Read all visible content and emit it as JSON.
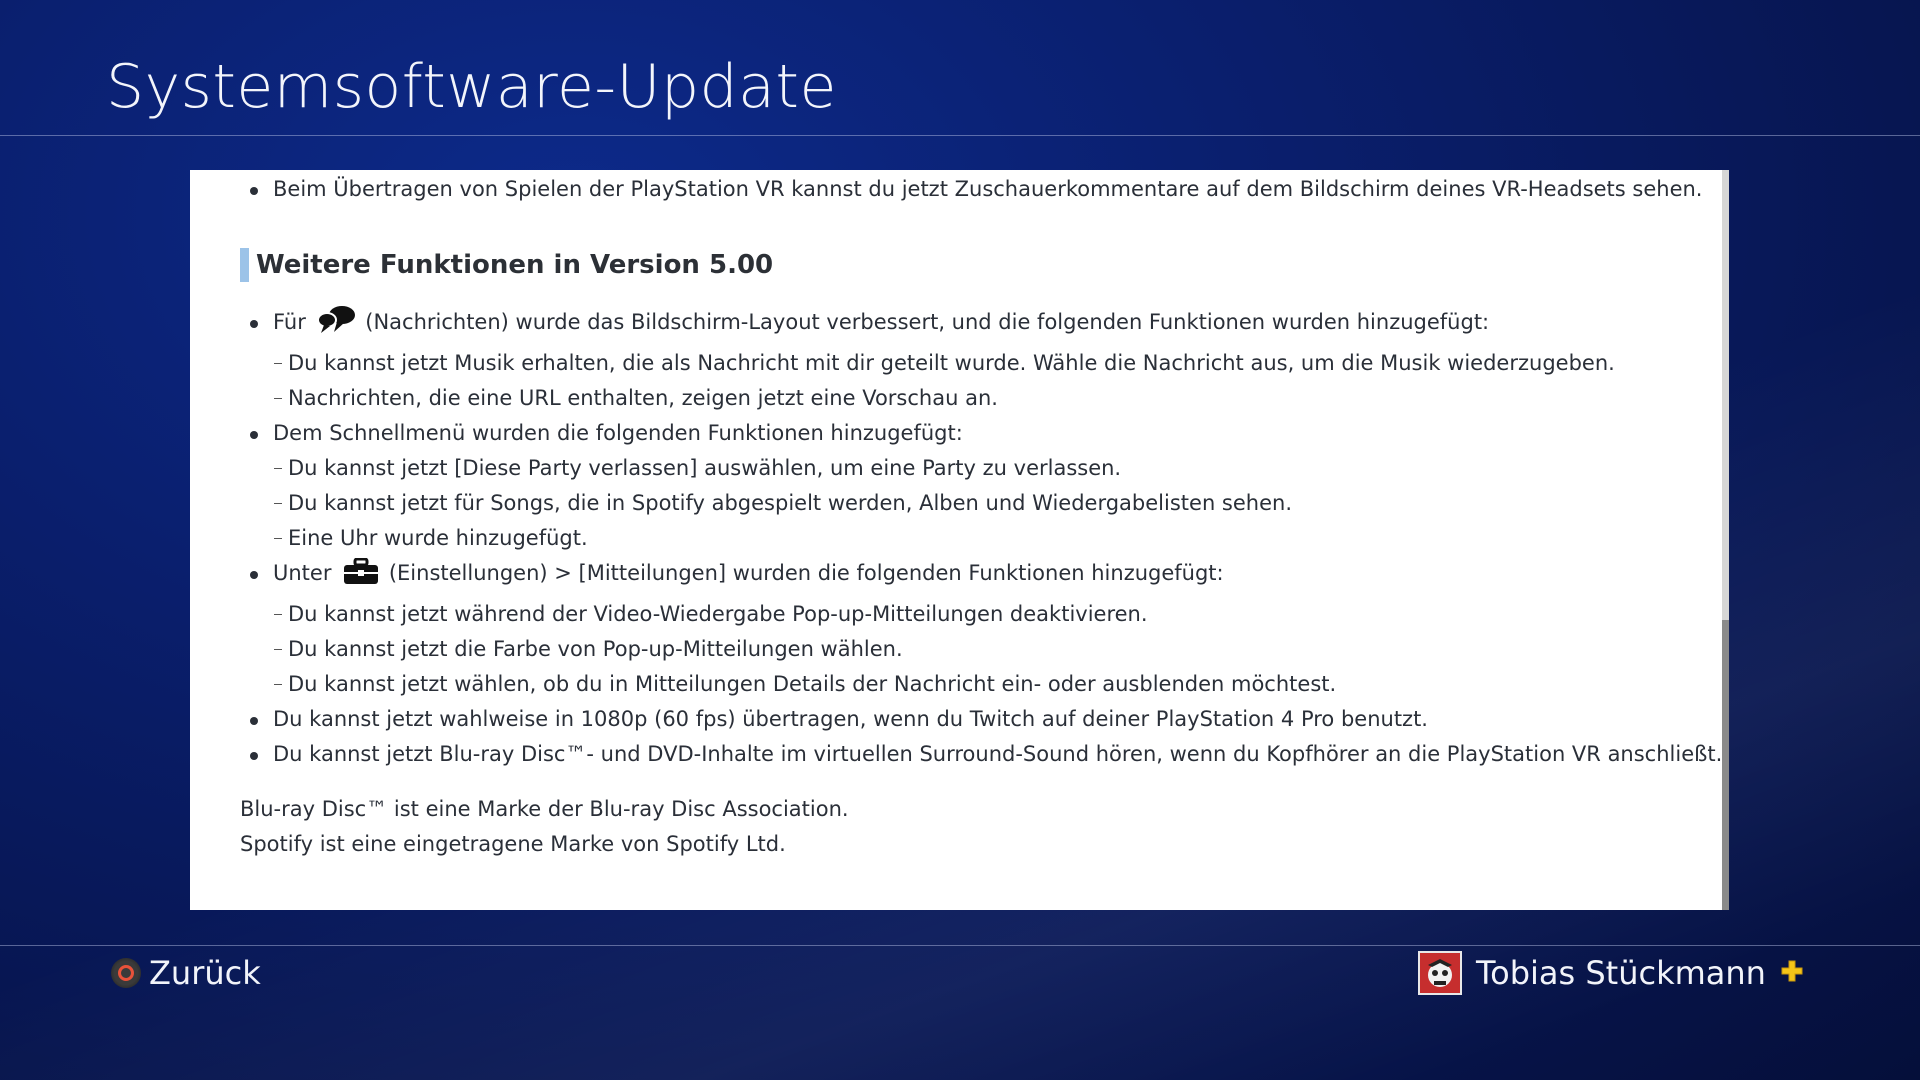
{
  "header": {
    "title": "Systemsoftware-Update"
  },
  "content": {
    "intro_bullet": "Beim Übertragen von Spielen der PlayStation VR kannst du jetzt Zuschauerkommentare auf dem Bildschirm deines VR-Headsets sehen.",
    "section_heading": "Weitere Funktionen in Version 5.00",
    "messages_bullet": {
      "prefix": "Für",
      "icon": "messages-icon",
      "suffix": "(Nachrichten) wurde das Bildschirm-Layout verbessert, und die folgenden Funktionen wurden hinzugefügt:",
      "subs": [
        "Du kannst jetzt Musik erhalten, die als Nachricht mit dir geteilt wurde. Wähle die Nachricht aus, um die Musik wiederzugeben.",
        "Nachrichten, die eine URL enthalten, zeigen jetzt eine Vorschau an."
      ]
    },
    "quickmenu_bullet": {
      "text": "Dem Schnellmenü wurden die folgenden Funktionen hinzugefügt:",
      "subs": [
        "Du kannst jetzt [Diese Party verlassen] auswählen, um eine Party zu verlassen.",
        "Du kannst jetzt für Songs, die in Spotify abgespielt werden, Alben und Wiedergabelisten sehen.",
        "Eine Uhr wurde hinzugefügt."
      ]
    },
    "settings_bullet": {
      "prefix": "Unter",
      "icon": "settings-toolbox-icon",
      "suffix": "(Einstellungen) > [Mitteilungen] wurden die folgenden Funktionen hinzugefügt:",
      "subs": [
        "Du kannst jetzt während der Video-Wiedergabe Pop-up-Mitteilungen deaktivieren.",
        "Du kannst jetzt die Farbe von Pop-up-Mitteilungen wählen.",
        "Du kannst jetzt wählen, ob du in Mitteilungen Details der Nachricht ein- oder ausblenden möchtest."
      ]
    },
    "twitch_bullet": "Du kannst jetzt wahlweise in 1080p (60 fps) übertragen, wenn du Twitch auf deiner PlayStation 4 Pro benutzt.",
    "bluray_bullet": "Du kannst jetzt Blu-ray Disc™- und DVD-Inhalte im virtuellen Surround-Sound hören, wenn du Kopfhörer an die PlayStation VR anschließt.",
    "notes": [
      "Blu-ray Disc™ ist eine Marke der Blu-ray Disc Association.",
      "Spotify ist eine eingetragene Marke von Spotify Ltd."
    ]
  },
  "footer": {
    "back_label": "Zurück",
    "back_icon": "circle-button-icon",
    "user_name": "Tobias Stückmann",
    "plus_icon": "playstation-plus-icon"
  },
  "colors": {
    "background": "#0a1f6e",
    "panel": "#ffffff",
    "heading_accent": "#9cc3e8",
    "circle_button": "#e8523a",
    "plus": "#f5c518"
  }
}
